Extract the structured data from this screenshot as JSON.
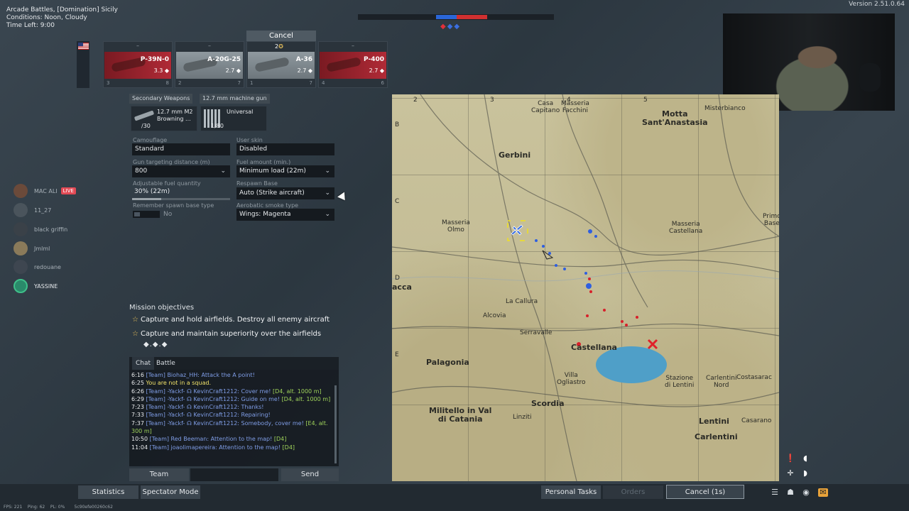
{
  "mission": {
    "title": "Arcade Battles, [Domination] Sicily",
    "conditions": "Conditions: Noon, Cloudy",
    "time_left": "Time Left: 9:00"
  },
  "version": "Version 2.51.0.64",
  "colors": {
    "allied": "#3b6fe0",
    "enemy": "#e0303a",
    "accent": "#e8a23a"
  },
  "vehicles": {
    "cancel_label": "Cancel",
    "slot3_badge": "2",
    "slots": [
      {
        "dash": "–",
        "name": "P-39N-0",
        "br": "3.3",
        "crew": "3",
        "extra": "8",
        "style": "red"
      },
      {
        "dash": "–",
        "name": "A-20G-25",
        "br": "2.7",
        "crew": "2",
        "extra": "7",
        "style": "gray"
      },
      {
        "dash": "",
        "name": "A-36",
        "br": "2.7",
        "crew": "1",
        "extra": "7",
        "style": "gray"
      },
      {
        "dash": "–",
        "name": "P-400",
        "br": "2.7",
        "crew": "4",
        "extra": "6",
        "style": "red"
      }
    ]
  },
  "weapons": {
    "secondary_tag": "Secondary Weapons",
    "gun_tag": "12.7 mm machine gun",
    "secondary": {
      "line1": "12.7 mm M2",
      "line2": "Browning ...",
      "count": "/30"
    },
    "belt": {
      "name": "Universal",
      "count": "1/80"
    }
  },
  "settings": {
    "camouflage": {
      "label": "Camouflage",
      "value": "Standard"
    },
    "user_skin": {
      "label": "User skin",
      "value": "Disabled"
    },
    "gun_distance": {
      "label": "Gun targeting distance (m)",
      "value": "800"
    },
    "fuel_amount": {
      "label": "Fuel amount (min.)",
      "value": "Minimum load (22m)"
    },
    "adjustable_fuel": {
      "label": "Adjustable fuel quantity",
      "value": "30% (22m)",
      "fraction": 0.3
    },
    "respawn": {
      "label": "Respawn Base",
      "value": "Auto (Strike aircraft)"
    },
    "remember": {
      "label": "Remember spawn base type",
      "value": "No"
    },
    "smoke": {
      "label": "Aerobatic smoke type",
      "value": "Wings: Magenta"
    }
  },
  "squad": [
    {
      "name": "MAC ALI",
      "live": "LIVE"
    },
    {
      "name": "11_27"
    },
    {
      "name": "black griffin"
    },
    {
      "name": "Jmlml"
    },
    {
      "name": "redouane"
    },
    {
      "name": "YASSINE"
    }
  ],
  "objectives": {
    "title": "Mission objectives",
    "items": [
      "Capture and hold airfields. Destroy all enemy aircraft",
      "Capture and maintain superiority over the airfields"
    ],
    "marks": "◆.◆.◆"
  },
  "chat": {
    "tabs": [
      "Chat",
      "Battle"
    ],
    "lines": [
      {
        "time": "6:16",
        "text": "[Team] Biohaz_HH: Attack the A point!",
        "grid": ""
      },
      {
        "time": "6:25",
        "text": "You are not in a squad.",
        "grid": "",
        "sys": true
      },
      {
        "time": "6:26",
        "text": "[Team] -Yackf- ☊ KevinCraft1212: Cover me!",
        "grid": "[D4, alt. 1000 m]"
      },
      {
        "time": "6:29",
        "text": "[Team] -Yackf- ☊ KevinCraft1212: Guide on me!",
        "grid": "[D4, alt. 1000 m]"
      },
      {
        "time": "7:23",
        "text": "[Team] -Yackf- ☊ KevinCraft1212: Thanks!",
        "grid": ""
      },
      {
        "time": "7:33",
        "text": "[Team] -Yackf- ☊ KevinCraft1212: Repairing!",
        "grid": ""
      },
      {
        "time": "7:37",
        "text": "[Team] -Yackf- ☊ KevinCraft1212: Somebody, cover me!",
        "grid": "[E4, alt. 300 m]"
      },
      {
        "time": "10:50",
        "text": "[Team] Red Beeman: Attention to the map!",
        "grid": "[D4]"
      },
      {
        "time": "11:04",
        "text": "[Team] joaolimapereira: Attention to the map!",
        "grid": "[D4]"
      }
    ],
    "team_label": "Team",
    "send_label": "Send",
    "input_value": ""
  },
  "map": {
    "cols": [
      "2",
      "3",
      "4",
      "5"
    ],
    "rows": [
      "B",
      "C",
      "D",
      "E"
    ],
    "places": [
      {
        "name": "Casa\nCapitano",
        "big": false
      },
      {
        "name": "Masseria\nFacchini",
        "big": false
      },
      {
        "name": "Motta\nSant'Anastasia",
        "big": true
      },
      {
        "name": "Misterbianco",
        "big": false
      },
      {
        "name": "Gerbini",
        "big": true
      },
      {
        "name": "Masseria\nOlmo",
        "big": false
      },
      {
        "name": "Masseria\nCastellana",
        "big": false
      },
      {
        "name": "Primo\nBase",
        "big": false
      },
      {
        "name": "acca",
        "big": true
      },
      {
        "name": "La Callura",
        "big": false
      },
      {
        "name": "Alcovia",
        "big": false
      },
      {
        "name": "Serravalle",
        "big": false
      },
      {
        "name": "Castellana",
        "big": true
      },
      {
        "name": "Palagonia",
        "big": true
      },
      {
        "name": "Villa\nOgliastro",
        "big": false
      },
      {
        "name": "Stazione\ndi Lentini",
        "big": false
      },
      {
        "name": "Carlentini\nNord",
        "big": false
      },
      {
        "name": "Costasarac",
        "big": false
      },
      {
        "name": "Militello in Val\ndi Catania",
        "big": true
      },
      {
        "name": "Linziti",
        "big": false
      },
      {
        "name": "Scordia",
        "big": true
      },
      {
        "name": "Lentini",
        "big": true
      },
      {
        "name": "Casarano",
        "big": false
      },
      {
        "name": "Carlentini",
        "big": true
      }
    ]
  },
  "bottom": {
    "statistics": "Statistics",
    "spectator": "Spectator Mode",
    "personal_tasks": "Personal Tasks",
    "orders": "Orders",
    "cancel": "Cancel (1s)"
  },
  "perf": {
    "fps": "FPS: 221",
    "ping": "Ping: 62",
    "pl": "PL: 0%",
    "session": "5c90efe00260c62"
  }
}
